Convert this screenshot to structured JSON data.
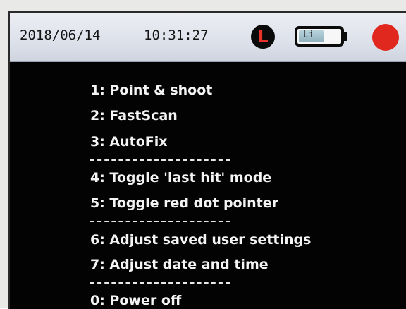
{
  "status_bar": {
    "date": "2018/06/14",
    "time": "10:31:27",
    "last_hit_indicator": "L",
    "battery_label": "Li",
    "battery_level": 0.6,
    "colors": {
      "record": "#e0281f",
      "last_hit_letter": "#e8332b"
    }
  },
  "menu": {
    "items": [
      "1: Point & shoot",
      "2: FastScan",
      "3: AutoFix",
      "4: Toggle 'last hit' mode",
      "5: Toggle red dot pointer",
      "6: Adjust saved user settings",
      "7: Adjust date and time",
      "0: Power off"
    ]
  }
}
